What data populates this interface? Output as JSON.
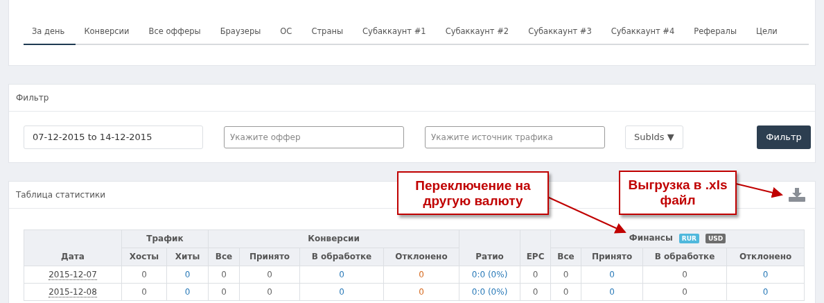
{
  "tabs": [
    {
      "label": "За день",
      "selected": true
    },
    {
      "label": "Конверсии",
      "selected": false
    },
    {
      "label": "Все офферы",
      "selected": false
    },
    {
      "label": "Браузеры",
      "selected": false
    },
    {
      "label": "ОС",
      "selected": false
    },
    {
      "label": "Страны",
      "selected": false
    },
    {
      "label": "Субаккаунт #1",
      "selected": false
    },
    {
      "label": "Субаккаунт #2",
      "selected": false
    },
    {
      "label": "Субаккаунт #3",
      "selected": false
    },
    {
      "label": "Субаккаунт #4",
      "selected": false
    },
    {
      "label": "Рефералы",
      "selected": false
    },
    {
      "label": "Цели",
      "selected": false
    }
  ],
  "filter": {
    "title": "Фильтр",
    "date_range": "07-12-2015 to 14-12-2015",
    "offer_placeholder": "Укажите оффер",
    "source_placeholder": "Укажите источник трафика",
    "subids_button": "SubIds ▼",
    "submit_button": "Фильтр"
  },
  "stats": {
    "title": "Таблица статистики",
    "groups": [
      {
        "label": "Трафик"
      },
      {
        "label": "Конверсии"
      },
      {
        "label": "Финансы"
      }
    ],
    "date_column": "Дата",
    "currencies": [
      {
        "label": "RUR",
        "selected": true
      },
      {
        "label": "USD",
        "selected": false
      }
    ],
    "columns": [
      {
        "label": "Хосты",
        "kind": "plain"
      },
      {
        "label": "Хиты",
        "kind": "link"
      },
      {
        "label": "Все",
        "kind": "plain"
      },
      {
        "label": "Принято",
        "kind": "plain"
      },
      {
        "label": "В обработке",
        "kind": "link"
      },
      {
        "label": "Отклонено",
        "kind": "rejected"
      },
      {
        "label": "Ратио",
        "kind": "link"
      },
      {
        "label": "EPC",
        "kind": "plain"
      },
      {
        "label": "Все",
        "kind": "plain"
      },
      {
        "label": "Принято",
        "kind": "link"
      },
      {
        "label": "В обработке",
        "kind": "plain"
      },
      {
        "label": "Отклонено",
        "kind": "link"
      }
    ],
    "rows": [
      {
        "date": "2015-12-07",
        "cells": [
          "0",
          "0",
          "0",
          "0",
          "0",
          "0",
          "0:0 (0%)",
          "0",
          "0",
          "0",
          "0",
          "0"
        ]
      },
      {
        "date": "2015-12-08",
        "cells": [
          "0",
          "0",
          "0",
          "0",
          "0",
          "0",
          "0:0 (0%)",
          "0",
          "0",
          "0",
          "0",
          "0"
        ]
      }
    ]
  },
  "callouts": [
    {
      "text": "Переключение на другую валюту"
    },
    {
      "text": "Выгрузка в .xls файл"
    }
  ]
}
